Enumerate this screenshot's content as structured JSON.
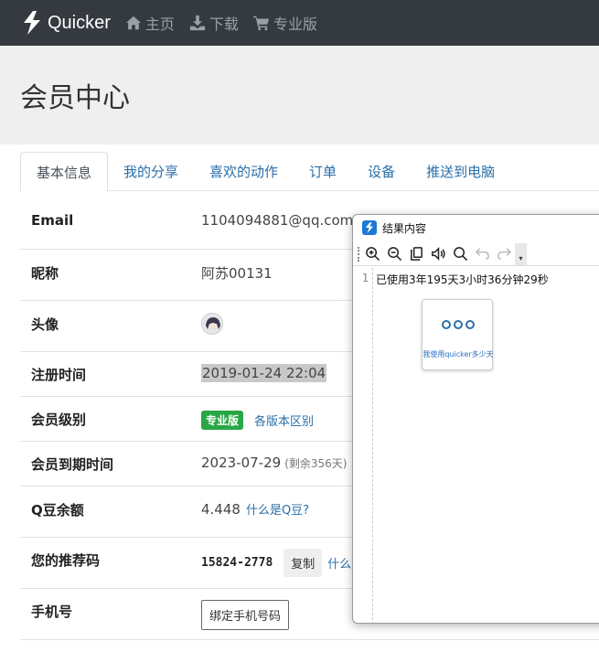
{
  "nav": {
    "brand": "Quicker",
    "items": [
      {
        "label": "主页",
        "icon": "home-icon"
      },
      {
        "label": "下载",
        "icon": "download-icon"
      },
      {
        "label": "专业版",
        "icon": "cart-icon"
      }
    ]
  },
  "page": {
    "title": "会员中心"
  },
  "tabs": [
    "基本信息",
    "我的分享",
    "喜欢的动作",
    "订单",
    "设备",
    "推送到电脑"
  ],
  "active_tab": "基本信息",
  "info": {
    "email": {
      "label": "Email",
      "value": "1104094881@qq.com"
    },
    "nickname": {
      "label": "昵称",
      "value": "阿苏00131"
    },
    "avatar": {
      "label": "头像"
    },
    "register": {
      "label": "注册时间",
      "value": "2019-01-24 22:04"
    },
    "level": {
      "label": "会员级别",
      "badge": "专业版",
      "link": "各版本区别"
    },
    "expire": {
      "label": "会员到期时间",
      "value": "2023-07-29",
      "remaining": "(剩余356天)"
    },
    "beans": {
      "label": "Q豆余额",
      "value": "4.448",
      "link": "什么是Q豆?"
    },
    "referral": {
      "label": "您的推荐码",
      "value": "15824-2778",
      "copy": "复制",
      "link": "什么"
    },
    "phone": {
      "label": "手机号",
      "button": "绑定手机号码"
    }
  },
  "popup": {
    "title": "结果内容",
    "line_number": "1",
    "text": "已使用3年195天3小时36分钟29秒",
    "card_caption": "我使用quicker多少天",
    "toolbar_more": "▾"
  },
  "colors": {
    "navbar": "#343a40",
    "link": "#2a6fa8",
    "badge": "#28a745"
  }
}
